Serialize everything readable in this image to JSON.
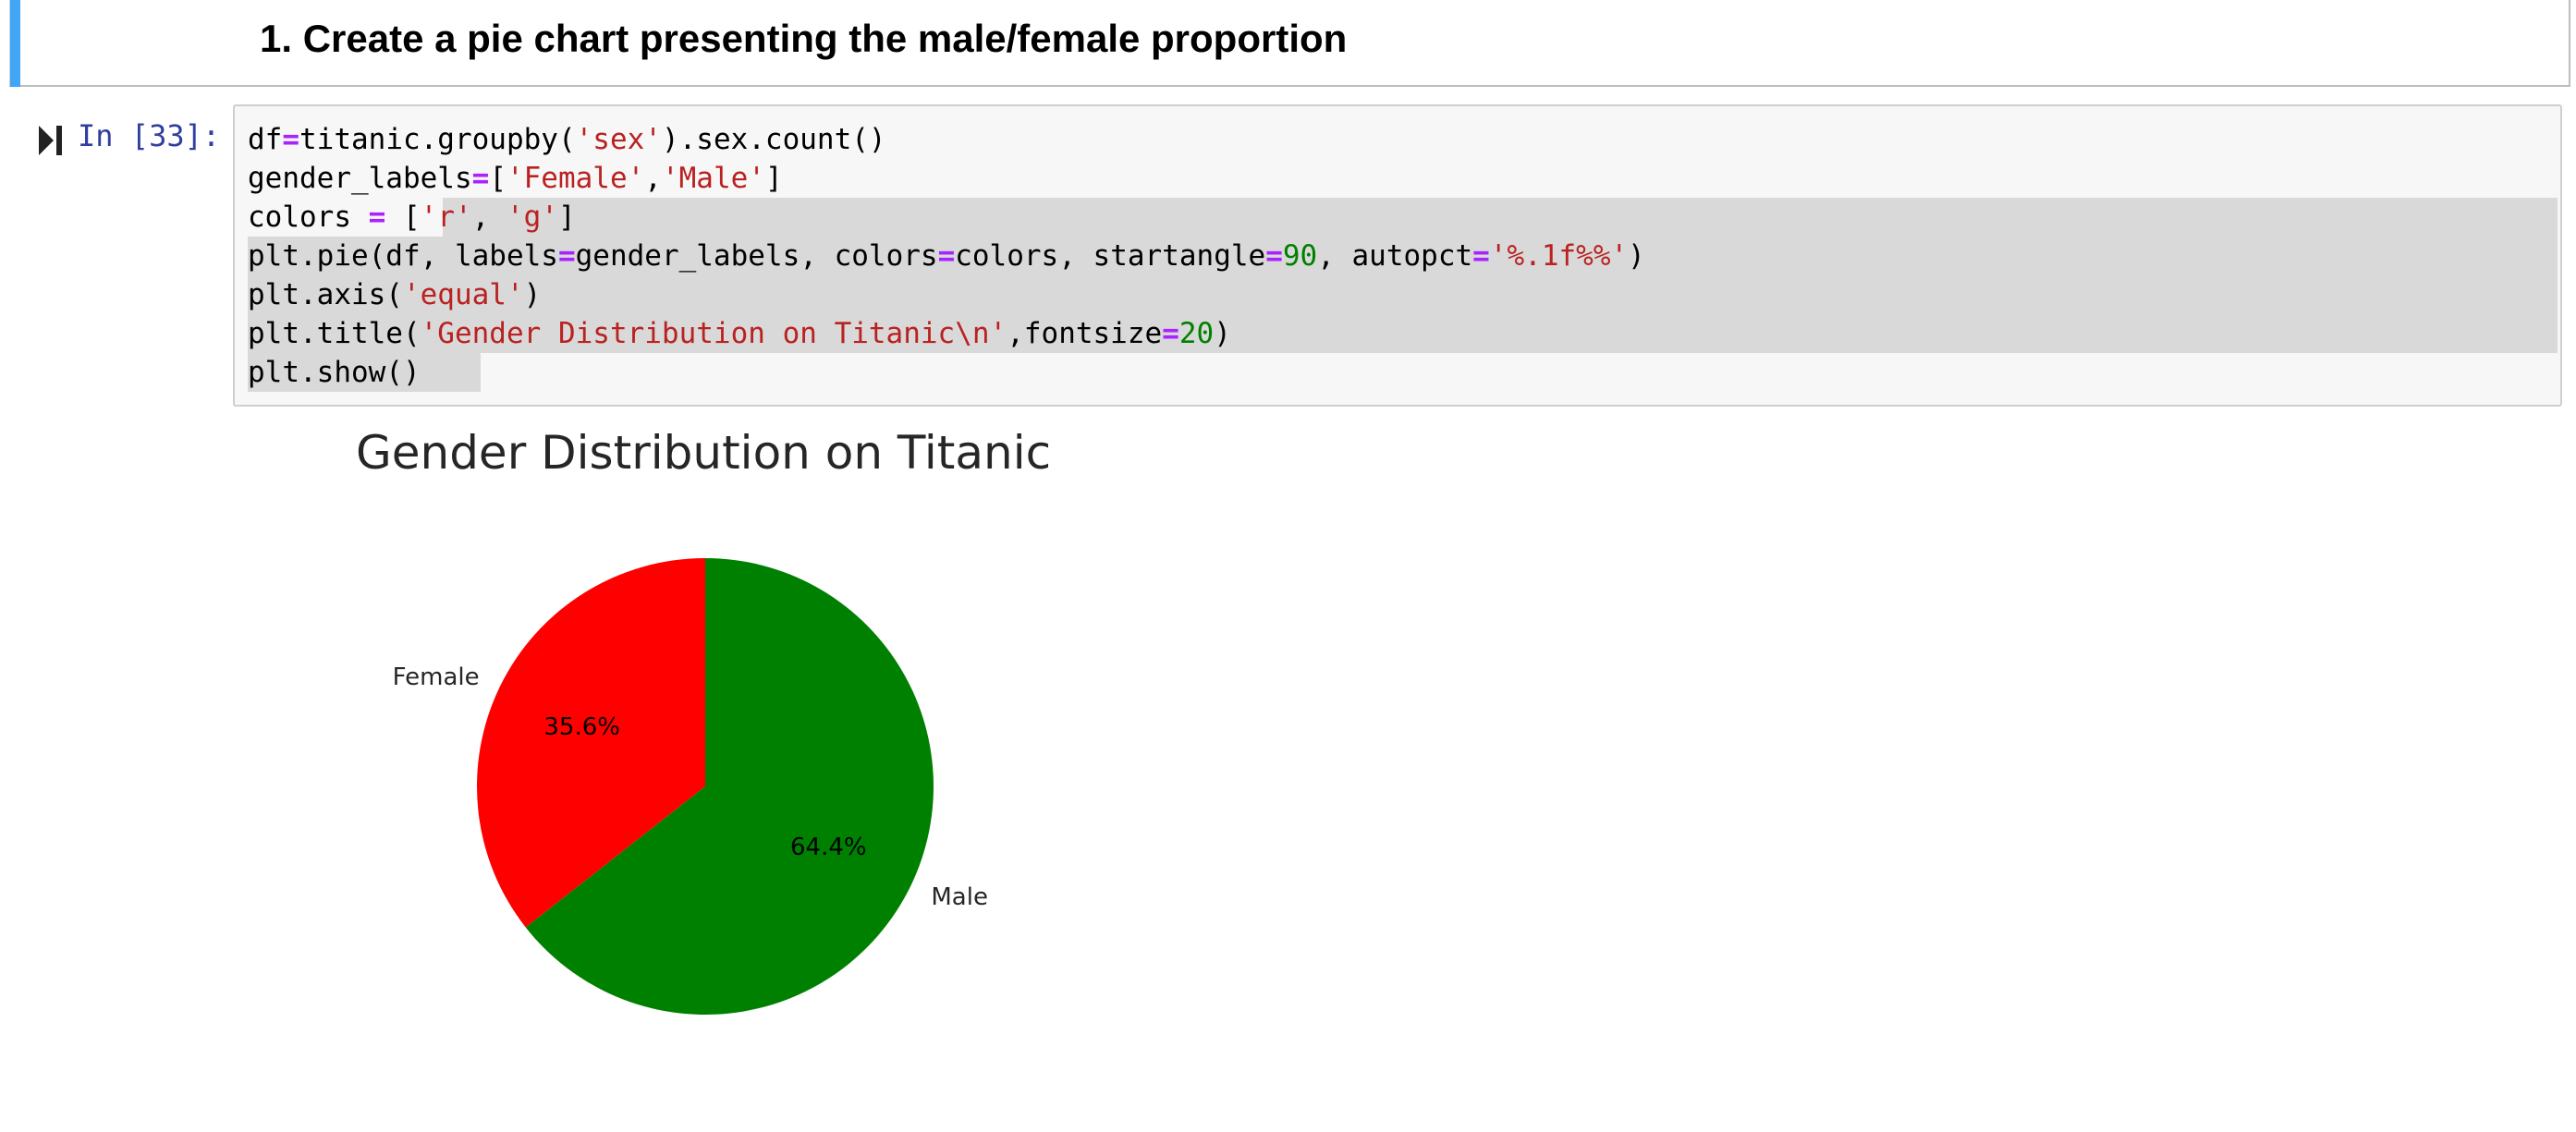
{
  "markdown_cell": {
    "heading": "1. Create a pie chart presenting the male/female proportion"
  },
  "code_cell": {
    "prompt": "In [33]:",
    "lines": [
      [
        {
          "t": "df"
        },
        {
          "t": "=",
          "c": "kw-op"
        },
        {
          "t": "titanic.groupby("
        },
        {
          "t": "'sex'",
          "c": "str"
        },
        {
          "t": ").sex.count()"
        }
      ],
      [
        {
          "t": "gender_labels"
        },
        {
          "t": "=",
          "c": "kw-op"
        },
        {
          "t": "["
        },
        {
          "t": "'Female'",
          "c": "str"
        },
        {
          "t": ","
        },
        {
          "t": "'Male'",
          "c": "str"
        },
        {
          "t": "]"
        }
      ],
      [
        {
          "t": "colors "
        },
        {
          "t": "=",
          "c": "kw-op"
        },
        {
          "t": " ["
        },
        {
          "t": "'r'",
          "c": "str"
        },
        {
          "t": ", "
        },
        {
          "t": "'g'",
          "c": "str"
        },
        {
          "t": "]"
        }
      ],
      [
        {
          "t": "plt.pie(df, labels"
        },
        {
          "t": "=",
          "c": "kw-op"
        },
        {
          "t": "gender_labels, colors"
        },
        {
          "t": "=",
          "c": "kw-op"
        },
        {
          "t": "colors, startangle"
        },
        {
          "t": "=",
          "c": "kw-op"
        },
        {
          "t": "90",
          "c": "num"
        },
        {
          "t": ", autopct"
        },
        {
          "t": "=",
          "c": "kw-op"
        },
        {
          "t": "'%.1f%%'",
          "c": "str"
        },
        {
          "t": ")"
        }
      ],
      [
        {
          "t": "plt.axis("
        },
        {
          "t": "'equal'",
          "c": "str"
        },
        {
          "t": ")"
        }
      ],
      [
        {
          "t": "plt.title("
        },
        {
          "t": "'Gender Distribution on Titanic\\n'",
          "c": "str"
        },
        {
          "t": ",fontsize"
        },
        {
          "t": "=",
          "c": "kw-op"
        },
        {
          "t": "20",
          "c": "num"
        },
        {
          "t": ")"
        }
      ],
      [
        {
          "t": "plt.show()"
        }
      ]
    ]
  },
  "chart_data": {
    "type": "pie",
    "title": "Gender Distribution on Titanic",
    "categories": [
      "Female",
      "Male"
    ],
    "values": [
      35.6,
      64.4
    ],
    "percent_labels": [
      "35.6%",
      "64.4%"
    ],
    "colors": [
      "#ff0000",
      "#008000"
    ],
    "startangle": 90
  }
}
